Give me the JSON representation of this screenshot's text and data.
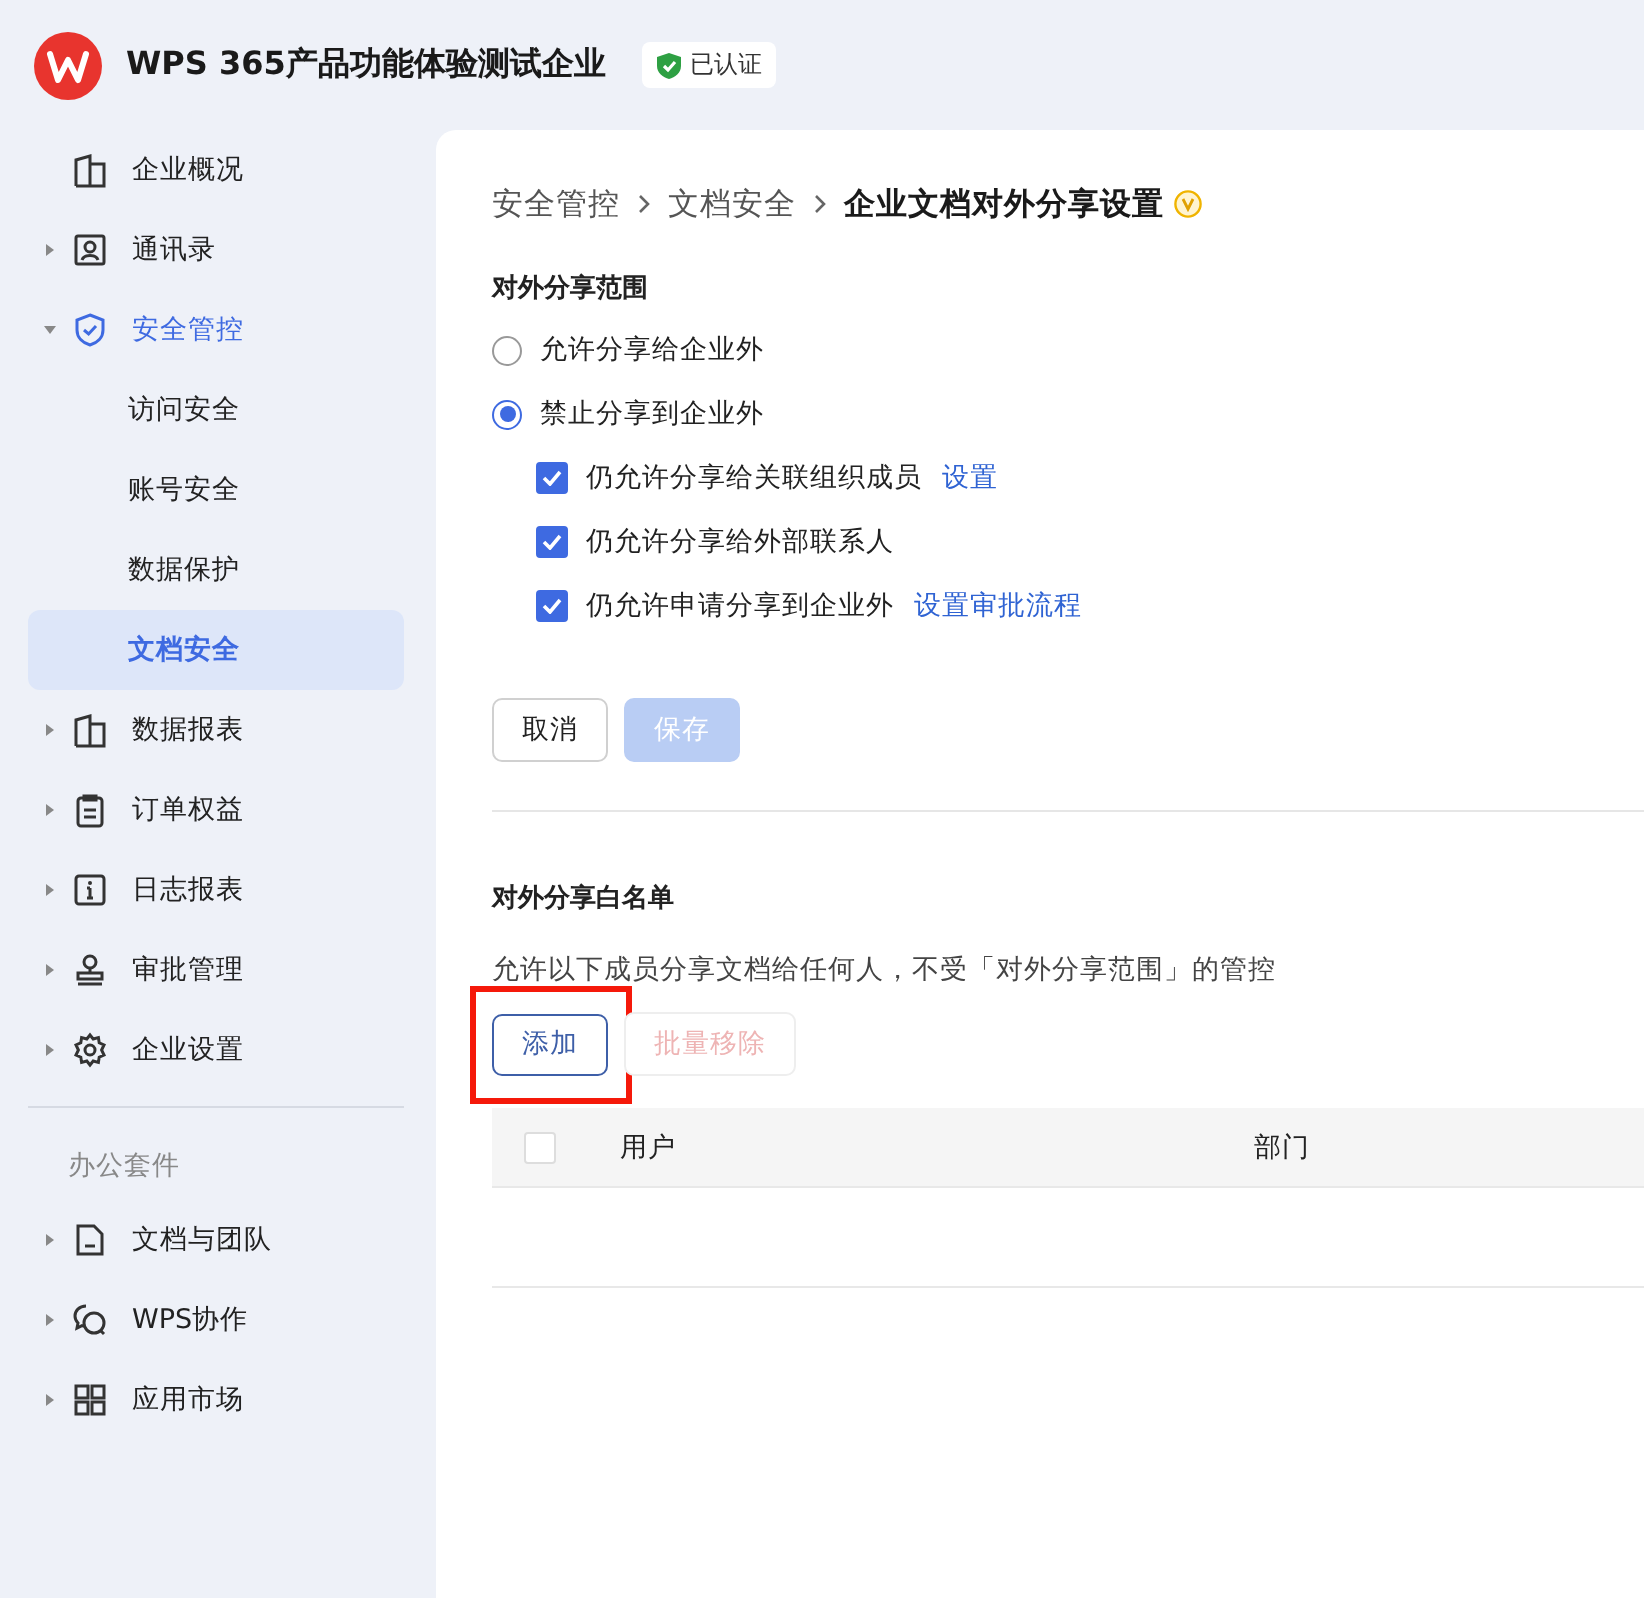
{
  "header": {
    "org_name": "WPS 365产品功能体验测试企业",
    "badge": "已认证"
  },
  "sidebar": {
    "sections": [
      {
        "items": [
          {
            "label": "企业概况",
            "active": false
          },
          {
            "label": "通讯录",
            "expanded": false,
            "active": false
          },
          {
            "label": "安全管控",
            "expanded": true,
            "active": true,
            "children": [
              {
                "label": "访问安全",
                "selected": false
              },
              {
                "label": "账号安全",
                "selected": false
              },
              {
                "label": "数据保护",
                "selected": false
              },
              {
                "label": "文档安全",
                "selected": true
              }
            ]
          },
          {
            "label": "数据报表",
            "expanded": false,
            "active": false
          },
          {
            "label": "订单权益",
            "expanded": false,
            "active": false
          },
          {
            "label": "日志报表",
            "expanded": false,
            "active": false
          },
          {
            "label": "审批管理",
            "expanded": false,
            "active": false
          },
          {
            "label": "企业设置",
            "expanded": false,
            "active": false
          }
        ]
      },
      {
        "title": "办公套件",
        "items": [
          {
            "label": "文档与团队",
            "expanded": false,
            "active": false
          },
          {
            "label": "WPS协作",
            "expanded": false,
            "active": false
          },
          {
            "label": "应用市场",
            "expanded": false,
            "active": false
          }
        ]
      }
    ]
  },
  "breadcrumb": [
    "安全管控",
    "文档安全",
    "企业文档对外分享设置"
  ],
  "scope": {
    "title": "对外分享范围",
    "radios": [
      {
        "label": "允许分享给企业外",
        "selected": false
      },
      {
        "label": "禁止分享到企业外",
        "selected": true
      }
    ],
    "options": [
      {
        "label": "仍允许分享给关联组织成员",
        "checked": true,
        "link": "设置"
      },
      {
        "label": "仍允许分享给外部联系人",
        "checked": true
      },
      {
        "label": "仍允许申请分享到企业外",
        "checked": true,
        "link": "设置审批流程"
      }
    ],
    "buttons": [
      {
        "label": "取消",
        "kind": "default",
        "disabled": false
      },
      {
        "label": "保存",
        "kind": "primary",
        "disabled": true
      }
    ]
  },
  "whitelist": {
    "title": "对外分享白名单",
    "description": "允许以下成员分享文档给任何人，不受「对外分享范围」的管控",
    "buttons": [
      {
        "label": "添加",
        "kind": "outline",
        "disabled": false,
        "highlighted": true
      },
      {
        "label": "批量移除",
        "kind": "danger",
        "disabled": true,
        "highlighted": false
      }
    ],
    "table": {
      "select_all": false,
      "columns": [
        "用户",
        "部门"
      ]
    }
  }
}
